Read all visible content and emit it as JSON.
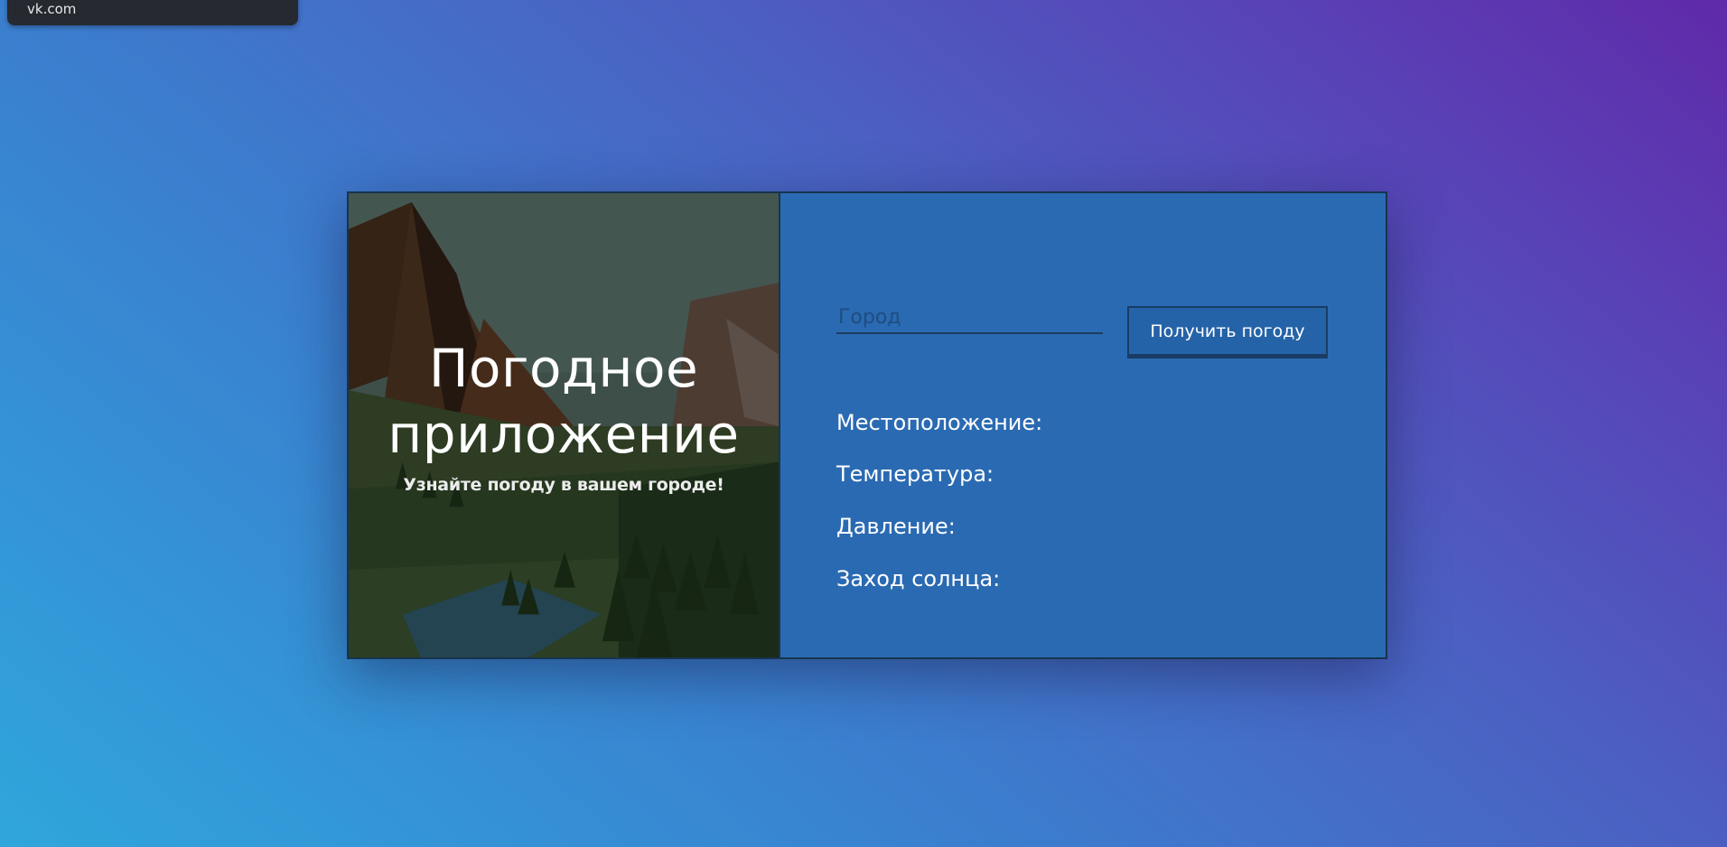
{
  "tooltip": {
    "text": "vk.com"
  },
  "hero": {
    "title": "Погодное приложение",
    "subtitle": "Узнайте погоду в вашем городе!"
  },
  "search": {
    "placeholder": "Город",
    "value": "",
    "button_label": "Получить погоду"
  },
  "weather": {
    "location_label": "Местоположение:",
    "temperature_label": "Температура:",
    "pressure_label": "Давление:",
    "sunset_label": "Заход солнца:"
  },
  "colors": {
    "panel": "#2a6ab2",
    "button": "#2563a8",
    "border": "#17344f"
  }
}
